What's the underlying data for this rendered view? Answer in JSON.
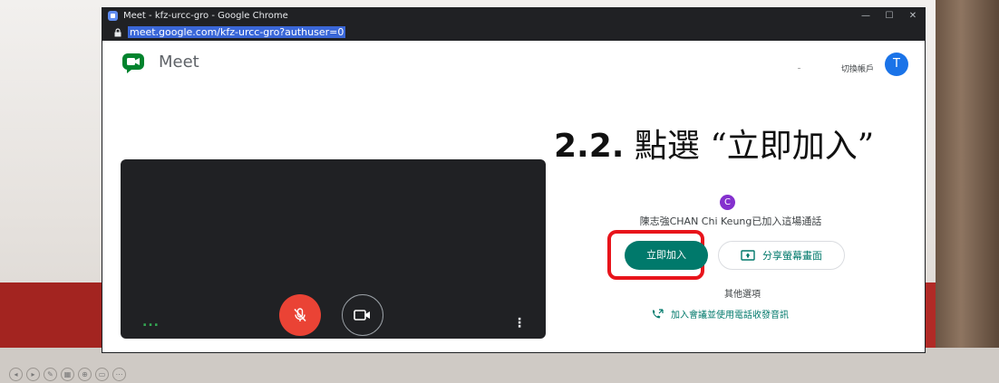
{
  "window": {
    "title": "Meet - kfz-urcc-gro - Google Chrome",
    "url": "meet.google.com/kfz-urcc-gro?authuser=0",
    "controls": [
      "—",
      "☐",
      "✕"
    ]
  },
  "header": {
    "app_name": "Meet",
    "switch_account": "切換帳戶",
    "avatar_letter": "T"
  },
  "preview": {
    "dots": "...",
    "kebab": "⋮"
  },
  "instruction": {
    "number": "2.2.",
    "text": " 點選 “立即加入”"
  },
  "participants": {
    "badge_letter": "C",
    "joined_text": "陳志強CHAN Chi Keung已加入這場通話"
  },
  "actions": {
    "join_label": "立即加入",
    "share_label": "分享螢幕畫面",
    "more_options": "其他選項",
    "phone_link": "加入會議並使用電話收發音訊"
  },
  "colors": {
    "accent": "#00796b",
    "mic_off": "#ea4335",
    "highlight_box": "#e8141b",
    "avatar": "#1a73e8",
    "badge": "#8430ce",
    "slide_band": "#b12a26"
  },
  "icons": {
    "meet_logo": "meet-logo-icon",
    "mic": "mic-off-icon",
    "camera": "camera-icon",
    "share": "present-screen-icon",
    "phone": "phone-icon",
    "lock": "lock-icon"
  }
}
